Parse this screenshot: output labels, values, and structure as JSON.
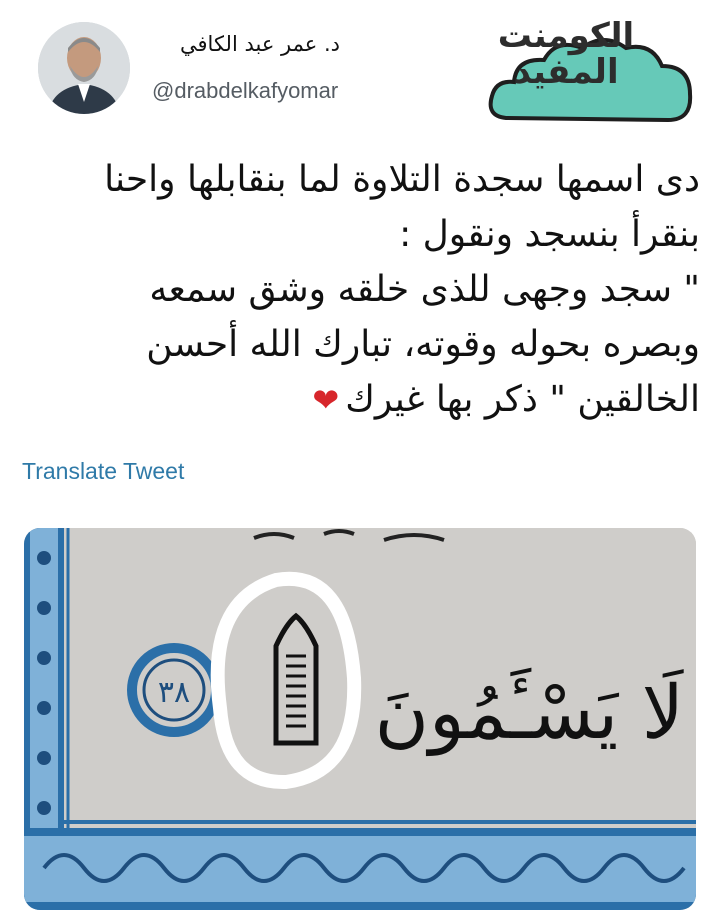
{
  "author": {
    "name": "د. عمر عبد الكافي",
    "handle": "@drabdelkafyomar"
  },
  "brand": {
    "logo_text": "الكومنت المفيد",
    "colors": {
      "cloud": "#66c9b8",
      "cloud_stroke": "#1e1e1e"
    }
  },
  "tweet": {
    "lines": [
      "دى اسمها سجدة التلاوة لما بنقابلها واحنا",
      "بنقرأ بنسجد ونقول :",
      "\" سجد وجهى للذى خلقه وشق سمعه",
      "وبصره بحوله وقوته، تبارك الله أحسن",
      "الخالقين \" ذكر بها غيرك"
    ],
    "emoji": "❤",
    "translate_label": "Translate Tweet"
  },
  "media": {
    "verse_text": "لَا يَسْـَٔمُونَ",
    "verse_number": "٣٨",
    "colors": {
      "border_blue": "#2b6fa8",
      "paper": "#cfcdca",
      "circle": "#ffffff"
    }
  }
}
